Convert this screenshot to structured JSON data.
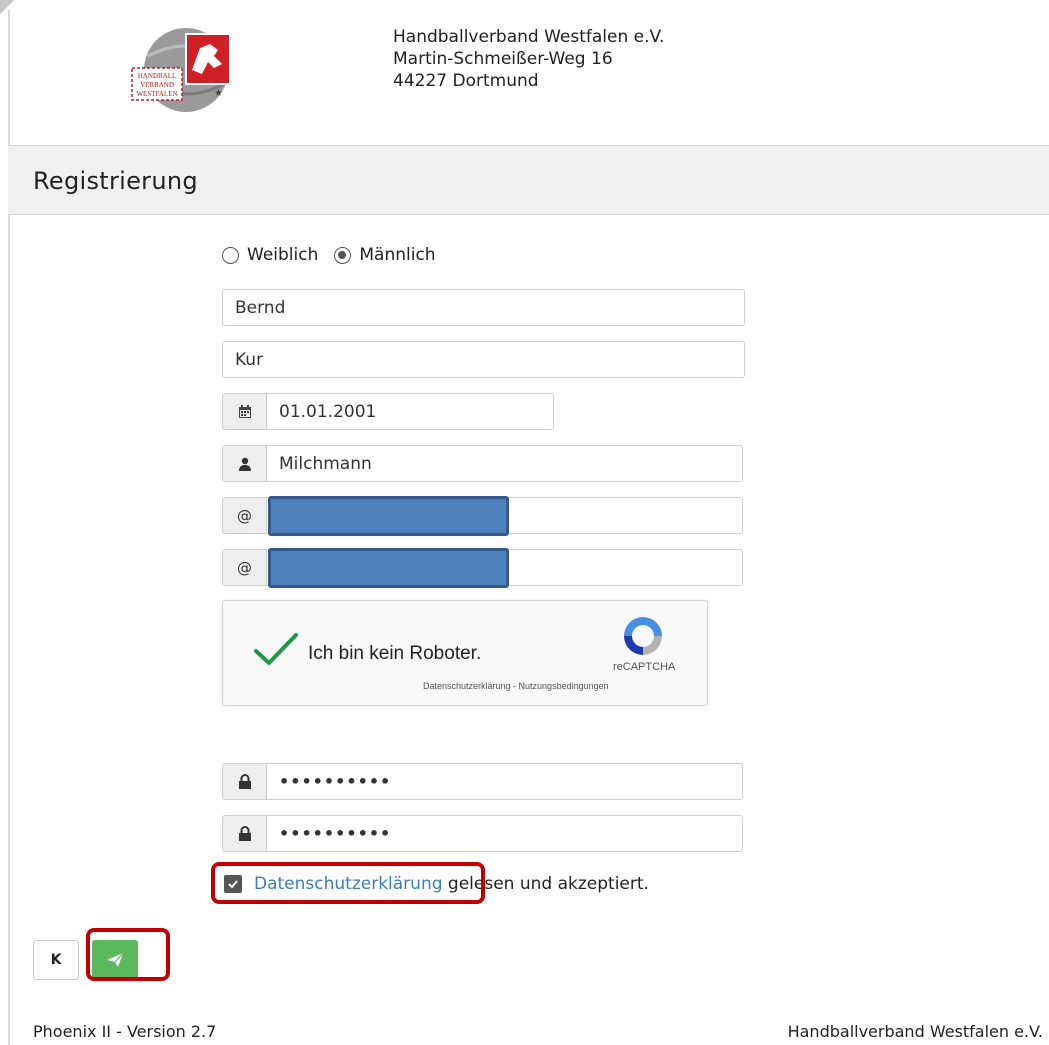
{
  "header": {
    "logo_icon": "handballverband-westfalen-logo",
    "logo_text": [
      "HANDBALL",
      "VERBAND",
      "WESTFALEN"
    ],
    "address_lines": [
      "Handballverband Westfalen e.V.",
      "Martin-Schmeißer-Weg 16",
      "44227 Dortmund"
    ]
  },
  "page_title": "Registrierung",
  "form": {
    "gender": {
      "options": [
        "Weiblich",
        "Männlich"
      ],
      "selected": "Männlich"
    },
    "first_name": "Bernd",
    "last_name": "Kur",
    "birthdate": {
      "icon": "calendar-icon",
      "value": "01.01.2001"
    },
    "username": {
      "icon": "user-icon",
      "value": "Milchmann"
    },
    "email": {
      "icon": "at-icon",
      "value": ""
    },
    "email_confirm": {
      "icon": "at-icon",
      "value": ""
    },
    "captcha": {
      "label": "Ich bin kein Roboter.",
      "brand": "reCAPTCHA",
      "links": "Datenschutzerklärung - Nutzungsbedingungen",
      "checked": true
    },
    "password": {
      "icon": "lock-icon",
      "value": "••••••••••"
    },
    "password_confirm": {
      "icon": "lock-icon",
      "value": "••••••••••"
    },
    "privacy": {
      "link": "Datenschutzerklärung",
      "text": " gelesen und akzeptiert.",
      "checked": true
    }
  },
  "buttons": {
    "back_label": "K",
    "send_icon": "paper-plane-icon"
  },
  "colors": {
    "primary_link": "#3a7dbb",
    "send_button": "#5cb85c",
    "highlight": "#c00000",
    "redaction": "#4f81bd"
  },
  "footer": {
    "version": "Phoenix II - Version 2.7",
    "org": "Handballverband Westfalen e.V."
  }
}
